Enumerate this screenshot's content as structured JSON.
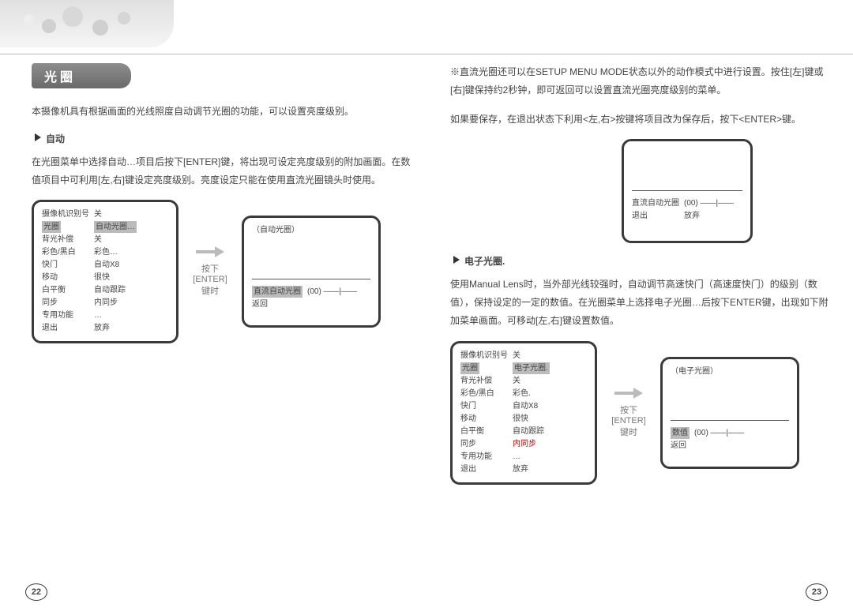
{
  "title": "光圈",
  "left": {
    "intro": "本摄像机具有根据画面的光线照度自动调节光圈的功能，可以设置亮度级别。",
    "sub1": "自动",
    "p1": "在光圈菜单中选择自动…项目后按下[ENTER]键，将出现可设定亮度级别的附加画面。在数值项目中可利用[左,右]键设定亮度级别。亮度设定只能在使用直流光圈镜头时使用。",
    "enter": "按下\n[ENTER]\n键时",
    "menu1": [
      [
        "摄像机识别号",
        "关"
      ],
      [
        "光圈",
        "自动光圈…"
      ],
      [
        "背光补偿",
        "关"
      ],
      [
        "彩色/黑白",
        "彩色…"
      ],
      [
        "快门",
        "自动X8"
      ],
      [
        "移动",
        "很快"
      ],
      [
        "白平衡",
        "自动跟踪"
      ],
      [
        "同步",
        "内同步"
      ],
      [
        "专用功能",
        "…"
      ],
      [
        "退出",
        "放弃"
      ]
    ],
    "menu2_title": "（自动光圈）",
    "menu2": [
      [
        "直流自动光圈",
        "(00) ——|——"
      ],
      [
        "返回",
        ""
      ]
    ]
  },
  "right": {
    "p1": "※直流光圈还可以在SETUP MENU MODE状态以外的动作模式中进行设置。按住[左]键或[右]键保持约2秒钟，即可返回可以设置直流光圈亮度级别的菜单。",
    "p2": "如果要保存，在退出状态下利用<左,右>按键将项目改为保存后，按下<ENTER>键。",
    "soloA": [
      [
        "直流自动光圈",
        "(00) ——|——"
      ],
      [
        "退出",
        "放弃"
      ]
    ],
    "sub2": "电子光圈.",
    "p3": "使用Manual Lens时，当外部光线较强时，自动调节高速快门（高速度快门）的级别（数值），保持设定的一定的数值。在光圈菜单上选择电子光圈…后按下ENTER键，出现如下附加菜单画面。可移动[左,右]键设置数值。",
    "enter": "按下\n[ENTER]\n键时",
    "menu3": [
      [
        "摄像机识别号",
        "关"
      ],
      [
        "光圈",
        "电子光圈."
      ],
      [
        "背光补偿",
        "关"
      ],
      [
        "彩色/黑白",
        "彩色."
      ],
      [
        "快门",
        "自动X8"
      ],
      [
        "移动",
        "很快"
      ],
      [
        "白平衡",
        "自动跟踪"
      ],
      [
        "同步",
        "内同步"
      ],
      [
        "专用功能",
        "…"
      ],
      [
        "退出",
        "放弃"
      ]
    ],
    "menu3_hl": "光圈",
    "menu3_hlv": "电子光圈.",
    "menu3_red": "内同步",
    "menu4_title": "（电子光圈）",
    "menu4": [
      [
        "数值",
        "(00) ——|——"
      ],
      [
        "返回",
        ""
      ]
    ],
    "menu4_hl": "数值"
  },
  "pages": {
    "l": "22",
    "r": "23"
  }
}
